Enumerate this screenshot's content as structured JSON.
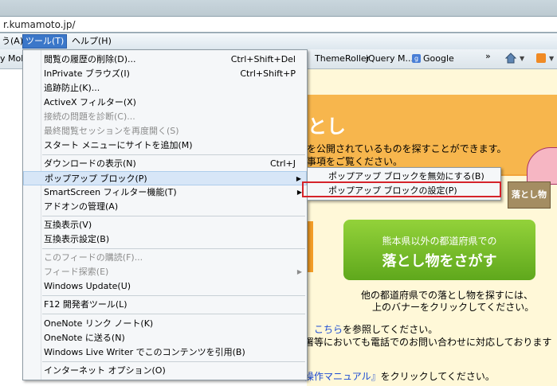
{
  "address_bar": {
    "url": "r.kumamoto.jp/"
  },
  "menubar": {
    "view": "う(A)",
    "tools": "ツール(T)",
    "help": "ヘルプ(H)"
  },
  "favorites": {
    "item1": "y Mob",
    "themeroller": "ThemeRoller",
    "jquery": "jQuery M...",
    "google": "Google",
    "more": "»"
  },
  "tools_menu": {
    "items": [
      {
        "label": "閲覧の履歴の削除(D)...",
        "shortcut": "Ctrl+Shift+Del",
        "disabled": false
      },
      {
        "label": "InPrivate ブラウズ(I)",
        "shortcut": "Ctrl+Shift+P",
        "disabled": false
      },
      {
        "label": "追跡防止(K)...",
        "shortcut": "",
        "disabled": false
      },
      {
        "label": "ActiveX フィルター(X)",
        "shortcut": "",
        "disabled": false
      },
      {
        "label": "接続の問題を診断(C)...",
        "shortcut": "",
        "disabled": true
      },
      {
        "label": "最終閲覧セッションを再度開く(S)",
        "shortcut": "",
        "disabled": true
      },
      {
        "label": "スタート メニューにサイトを追加(M)",
        "shortcut": "",
        "disabled": false
      },
      {
        "label": "ダウンロードの表示(N)",
        "shortcut": "Ctrl+J",
        "disabled": false
      },
      {
        "label": "ポップアップ ブロック(P)",
        "shortcut": "",
        "disabled": false
      },
      {
        "label": "SmartScreen フィルター機能(T)",
        "shortcut": "",
        "disabled": false
      },
      {
        "label": "アドオンの管理(A)",
        "shortcut": "",
        "disabled": false
      },
      {
        "label": "互換表示(V)",
        "shortcut": "",
        "disabled": false
      },
      {
        "label": "互換表示設定(B)",
        "shortcut": "",
        "disabled": false
      },
      {
        "label": "このフィードの購読(F)...",
        "shortcut": "",
        "disabled": true
      },
      {
        "label": "フィード探索(E)",
        "shortcut": "",
        "disabled": true
      },
      {
        "label": "Windows Update(U)",
        "shortcut": "",
        "disabled": false
      },
      {
        "label": "F12 開発者ツール(L)",
        "shortcut": "",
        "disabled": false
      },
      {
        "label": "OneNote リンク ノート(K)",
        "shortcut": "",
        "disabled": false
      },
      {
        "label": "OneNote に送る(N)",
        "shortcut": "",
        "disabled": false
      },
      {
        "label": "Windows Live Writer でこのコンテンツを引用(B)",
        "shortcut": "",
        "disabled": false
      },
      {
        "label": "インターネット オプション(O)",
        "shortcut": "",
        "disabled": false
      }
    ]
  },
  "popup_submenu": {
    "items": [
      {
        "label": "ポップアップ ブロックを無効にする(B)"
      },
      {
        "label": "ポップアップ ブロックの設定(P)"
      }
    ]
  },
  "page": {
    "banner_word": "とし",
    "line_search": "を公開されているものを探すことができます。",
    "line_notes": "事項をご覧ください。",
    "lost_badge": "落とし物",
    "green_line1": "熊本県以外の都道府県での",
    "green_line2": "落とし物をさがす",
    "other1": "他の都道府県での落とし物を探すには、",
    "other2": "上のバナーをクリックしてください。",
    "see_link": "こちら",
    "see_rest": "を参照してください。",
    "phone": "署等においても電話でのお問い合わせに対応しております",
    "manual_link": "操作マニュアル』",
    "manual_rest": "をクリックしてください。"
  },
  "colors": {
    "highlight": "#d7e6f7",
    "red_box": "#d5232a",
    "green": "#5fa81c",
    "orange": "#f7b64d"
  }
}
